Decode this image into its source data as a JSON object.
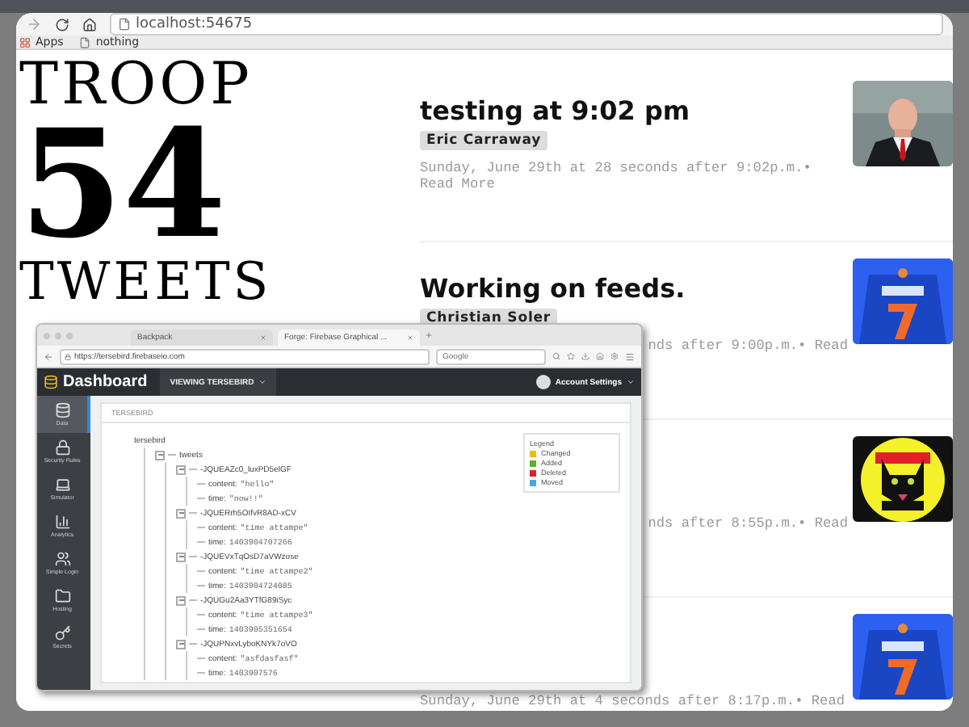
{
  "browser": {
    "url": "localhost:54675",
    "bookmarks": [
      {
        "label": "Apps",
        "kind": "apps"
      },
      {
        "label": "nothing",
        "kind": "page"
      }
    ]
  },
  "logo": {
    "top": "TROOP",
    "number": "54",
    "bottom": "TWEETS"
  },
  "posts": [
    {
      "title": "testing at 9:02 pm",
      "author": "Eric Carraway",
      "meta": "Sunday, June 29th at 28 seconds after 9:02p.m.• Read More",
      "meta_partial": false
    },
    {
      "title": "Working on feeds.",
      "author": "Christian Soler",
      "meta": "nds after 9:00p.m.• Read",
      "meta_partial": true
    },
    {
      "meta": "nds after 8:55p.m.• Read",
      "meta_partial": true
    },
    {
      "meta": "Sunday, June 29th at 4 seconds after 8:17p.m.• Read",
      "meta_partial": false
    }
  ],
  "overlay": {
    "tabs": [
      {
        "label": "Backpack",
        "selected": false
      },
      {
        "label": "Forge: Firebase Graphical ...",
        "selected": true
      }
    ],
    "url": "https://tersebird.firebaseio.com",
    "search_placeholder": "Google",
    "app_title": "Dashboard",
    "viewing": "VIEWING TERSEBIRD",
    "account": "Account Settings",
    "sidebar": [
      {
        "label": "Data",
        "selected": true,
        "kind": "data"
      },
      {
        "label": "Security Rules",
        "selected": false,
        "kind": "security"
      },
      {
        "label": "Simulator",
        "selected": false,
        "kind": "simulator"
      },
      {
        "label": "Analytics",
        "selected": false,
        "kind": "analytics"
      },
      {
        "label": "Simple Login",
        "selected": false,
        "kind": "login"
      },
      {
        "label": "Hosting",
        "selected": false,
        "kind": "hosting"
      },
      {
        "label": "Secrets",
        "selected": false,
        "kind": "secrets"
      }
    ],
    "breadcrumb": "TERSEBIRD",
    "tree": {
      "label": "tersebird",
      "children": [
        {
          "label": "tweets",
          "expanded": true,
          "children": [
            {
              "label": "-JQUEAZc0_luxPD5elGF",
              "expanded": true,
              "children": [
                {
                  "label": "content:",
                  "value": "\"hello\""
                },
                {
                  "label": "time:",
                  "value": "\"now!!\""
                }
              ]
            },
            {
              "label": "-JQUERrh5OIfvR8AD-xCV",
              "expanded": true,
              "children": [
                {
                  "label": "content:",
                  "value": "\"time attampe\""
                },
                {
                  "label": "time:",
                  "value": "1403904707266"
                }
              ]
            },
            {
              "label": "-JQUEVxTqOsD7aVWzose",
              "expanded": true,
              "children": [
                {
                  "label": "content:",
                  "value": "\"time attampe2\""
                },
                {
                  "label": "time:",
                  "value": "1403904724085"
                }
              ]
            },
            {
              "label": "-JQUGu2Aa3YTfG89iSyc",
              "expanded": true,
              "children": [
                {
                  "label": "content:",
                  "value": "\"time attampe3\""
                },
                {
                  "label": "time:",
                  "value": "1403905351654"
                }
              ]
            },
            {
              "label": "-JQUPNxvLyboKNYk7oVO",
              "expanded": true,
              "children": [
                {
                  "label": "content:",
                  "value": "\"asfdasfasf\""
                },
                {
                  "label": "time:",
                  "value": "1403907576"
                }
              ]
            }
          ]
        }
      ]
    },
    "legend": {
      "title": "Legend",
      "items": [
        {
          "label": "Changed",
          "color": "#f5b915"
        },
        {
          "label": "Added",
          "color": "#6aaa2e"
        },
        {
          "label": "Deleted",
          "color": "#d9262b"
        },
        {
          "label": "Moved",
          "color": "#4ca6d8"
        }
      ]
    }
  }
}
